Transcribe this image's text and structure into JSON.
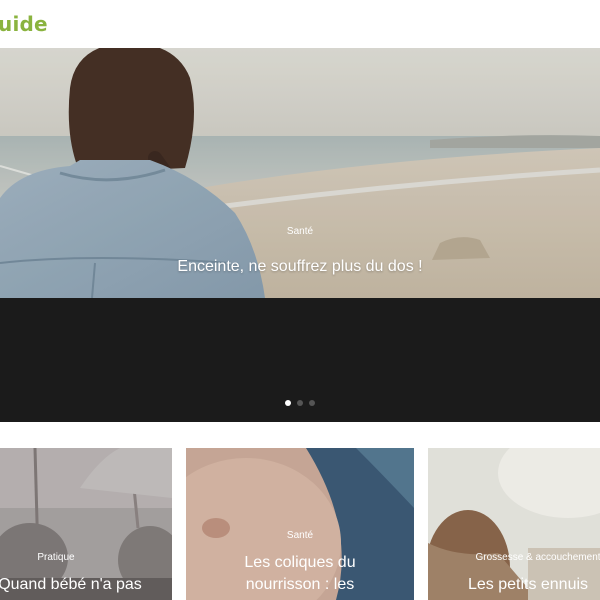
{
  "header": {
    "logo_text": "uide"
  },
  "hero": {
    "category": "Santé",
    "title": "Enceinte, ne souffrez plus du dos !"
  },
  "slider": {
    "dot_count": 3,
    "active_index": 0
  },
  "cards": [
    {
      "category": "Pratique",
      "title": "Quand bébé n'a pas"
    },
    {
      "category": "Santé",
      "title_line1": "Les coliques du",
      "title_line2": "nourrisson : les"
    },
    {
      "category": "Grossesse & accouchement",
      "title": "Les petits ennuis"
    }
  ]
}
